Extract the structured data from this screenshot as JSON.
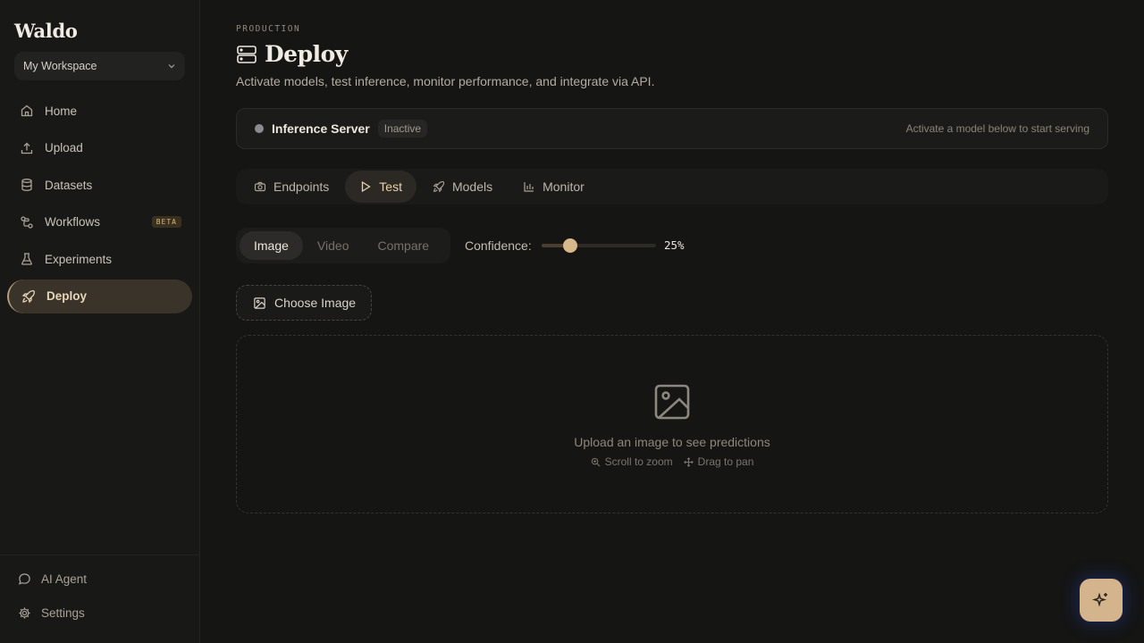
{
  "app": {
    "brand": "Waldo"
  },
  "sidebar": {
    "workspace": "My Workspace",
    "items": [
      {
        "label": "Home",
        "icon": "home-icon"
      },
      {
        "label": "Upload",
        "icon": "upload-icon"
      },
      {
        "label": "Datasets",
        "icon": "database-icon"
      },
      {
        "label": "Workflows",
        "icon": "workflow-icon",
        "badge": "BETA"
      },
      {
        "label": "Experiments",
        "icon": "flask-icon"
      },
      {
        "label": "Deploy",
        "icon": "rocket-icon",
        "active": true
      }
    ],
    "bottom": [
      {
        "label": "AI Agent",
        "icon": "chat-icon"
      },
      {
        "label": "Settings",
        "icon": "gear-icon"
      }
    ]
  },
  "header": {
    "eyebrow": "PRODUCTION",
    "title": "Deploy",
    "subtitle": "Activate models, test inference, monitor performance, and integrate via API."
  },
  "server": {
    "name": "Inference Server",
    "status": "Inactive",
    "hint": "Activate a model below to start serving"
  },
  "tabs": [
    {
      "label": "Endpoints",
      "icon": "camera-icon"
    },
    {
      "label": "Test",
      "icon": "play-icon",
      "active": true
    },
    {
      "label": "Models",
      "icon": "rocket-icon"
    },
    {
      "label": "Monitor",
      "icon": "bar-chart-icon"
    }
  ],
  "test": {
    "modes": [
      {
        "label": "Image",
        "active": true
      },
      {
        "label": "Video"
      },
      {
        "label": "Compare"
      }
    ],
    "confidence_label": "Confidence:",
    "confidence_value": 25,
    "confidence_text": "25%",
    "choose_label": "Choose Image",
    "dropzone_text": "Upload an image to see predictions",
    "hint_zoom": "Scroll to zoom",
    "hint_pan": "Drag to pan"
  },
  "colors": {
    "accent": "#d3b48c",
    "background": "#151514"
  }
}
